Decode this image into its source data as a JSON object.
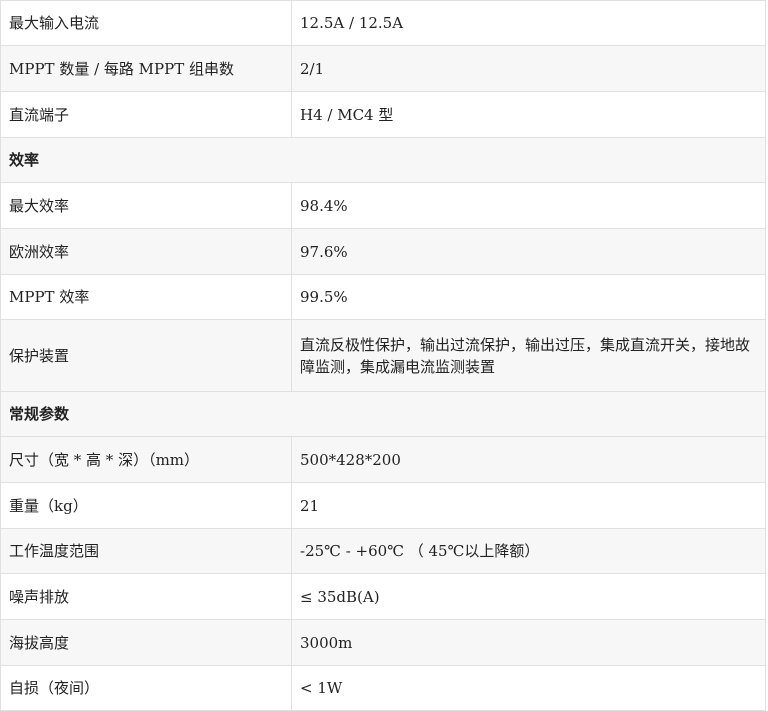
{
  "rows": [
    {
      "label": "最大输入电流",
      "value": "12.5A / 12.5A"
    },
    {
      "label": "MPPT 数量 / 每路 MPPT 组串数",
      "value": "2/1"
    },
    {
      "label": "直流端子",
      "value": "H4 / MC4 型"
    },
    {
      "section": "效率"
    },
    {
      "label": "最大效率",
      "value": "98.4%"
    },
    {
      "label": "欧洲效率",
      "value": "97.6%"
    },
    {
      "label": "MPPT 效率",
      "value": "99.5%"
    },
    {
      "label": "保护装置",
      "value": "直流反极性保护，输出过流保护，输出过压，集成直流开关，接地故障监测，集成漏电流监测装置"
    },
    {
      "section": "常规参数"
    },
    {
      "label": "尺寸（宽 * 高 * 深）（mm）",
      "value": "500*428*200"
    },
    {
      "label": "重量（kg）",
      "value": "21"
    },
    {
      "label": "工作温度范围",
      "value": "-25℃ - +60℃ （ 45℃以上降额）"
    },
    {
      "label": "噪声排放",
      "value": "≤ 35dB(A)"
    },
    {
      "label": "海拔高度",
      "value": "3000m"
    },
    {
      "label": "自损（夜间）",
      "value": "< 1W"
    }
  ]
}
